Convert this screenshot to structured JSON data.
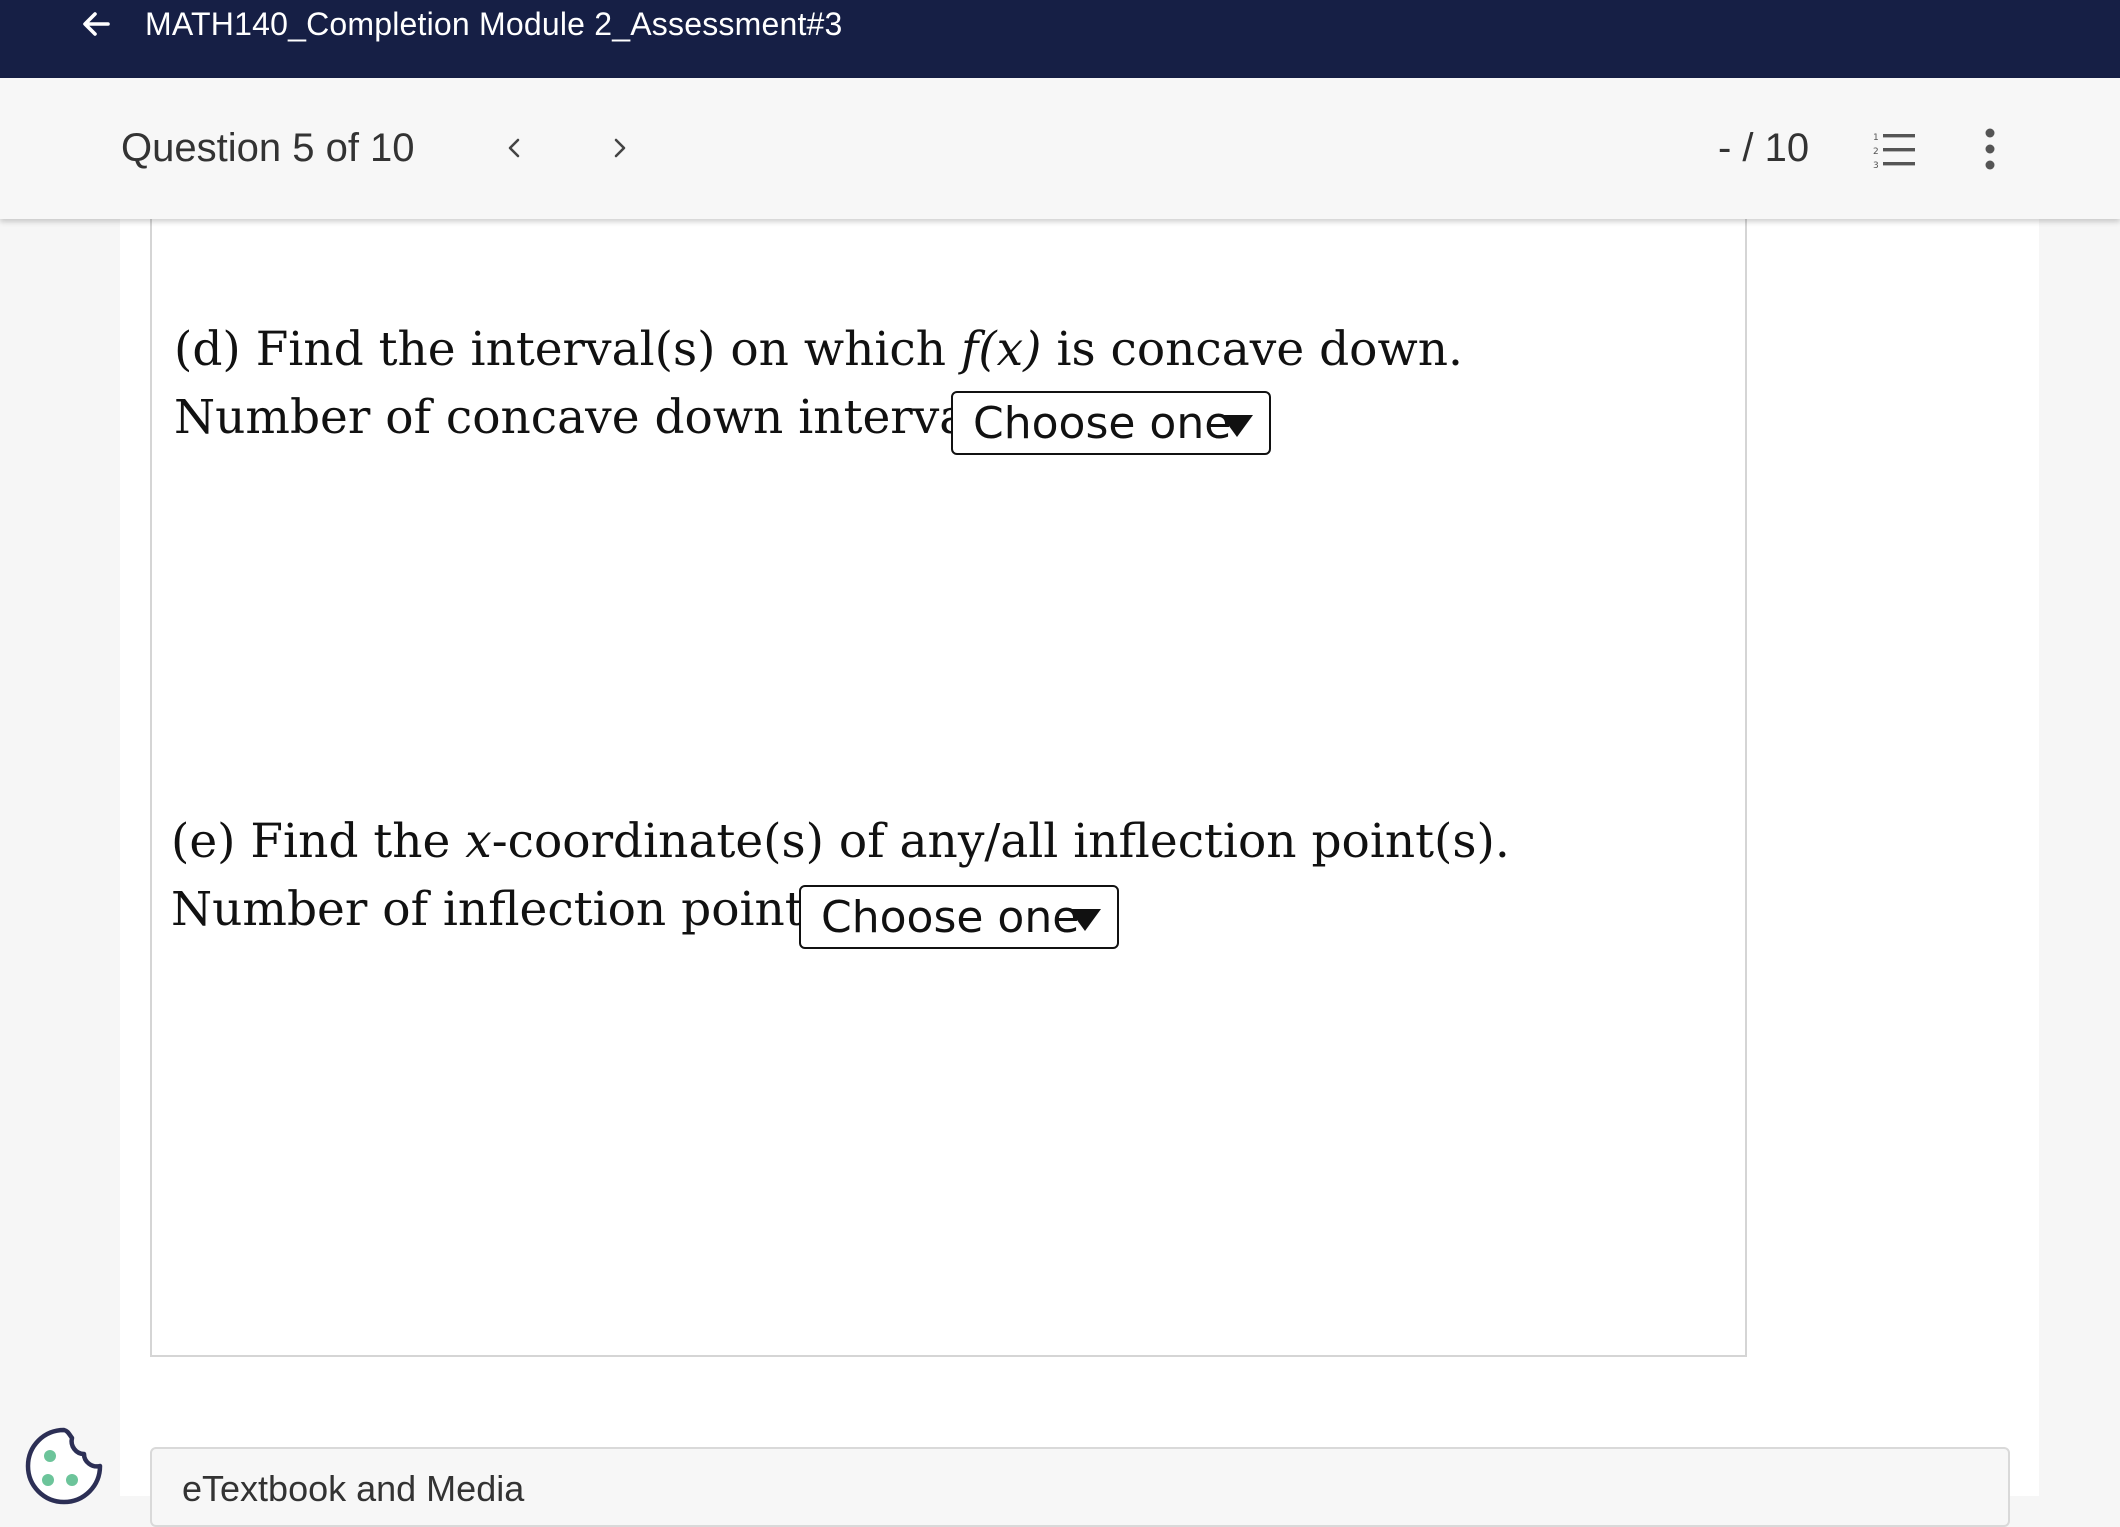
{
  "topbar": {
    "title": "MATH140_Completion Module 2_Assessment#3",
    "back_icon": "arrow-left-icon",
    "background": "#161f45"
  },
  "question_header": {
    "counter": "Question 5 of 10",
    "prev_icon": "chevron-left-icon",
    "next_icon": "chevron-right-icon",
    "score": "- / 10",
    "list_icon": "numbered-list-icon",
    "more_icon": "more-vertical-icon"
  },
  "question": {
    "part_d": {
      "prefix": "(d) Find the interval(s) on which ",
      "math": "f(x)",
      "suffix": " is concave down.",
      "count_label": "Number of concave down intervals:",
      "dropdown_value": "Choose one"
    },
    "part_e": {
      "prefix": "(e) Find the ",
      "math": "x",
      "suffix": "-coordinate(s) of any/all inflection point(s).",
      "count_label": "Number of inflection points:",
      "dropdown_value": "Choose one"
    }
  },
  "resources": {
    "etextbook_label": "eTextbook and Media"
  },
  "cookie": {
    "icon": "cookie-icon",
    "accent": "#6cc49a"
  }
}
